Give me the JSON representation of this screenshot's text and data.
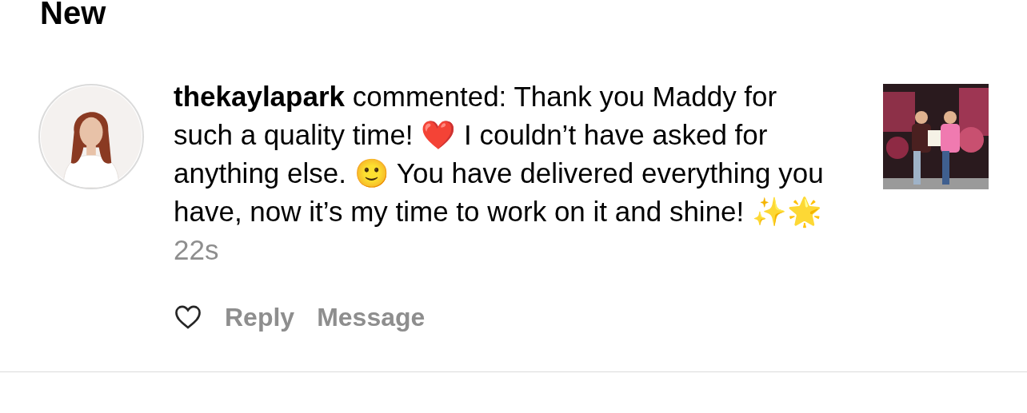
{
  "section_title": "New",
  "notification": {
    "comment": "**thekaylapark** commented: Thank you Maddy for such a quality time! ❤️ I couldn’t have asked for anything else. 🙂 You have delivered everything you have, now it’s my time to work on it and shine! ✨🌟",
    "time": "22s",
    "liked": false,
    "actions": [
      "Reply",
      "Message"
    ]
  }
}
